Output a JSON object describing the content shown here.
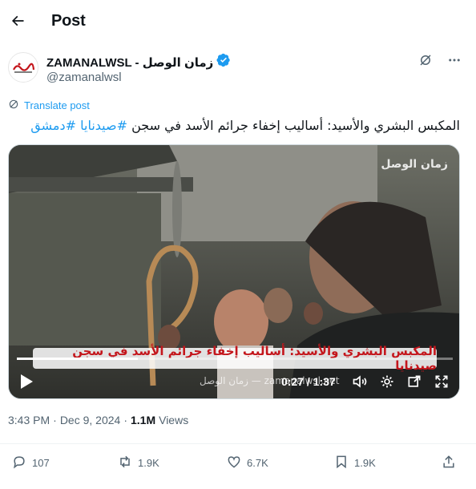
{
  "header": {
    "title": "Post"
  },
  "author": {
    "display_name": "ZAMANALWSL - زمان الوصل",
    "handle": "@zamanalwsl",
    "verified": true,
    "avatar_text": "زمان الوصل"
  },
  "translate_label": "Translate post",
  "post": {
    "text": "المكبس البشري والأسيد: أساليب إخفاء جرائم الأسد في سجن ",
    "hashtags": [
      "#صيدنايا",
      "#دمشق"
    ]
  },
  "video": {
    "caption": "المكبس البشري والأسيد: أساليب إخفاء جرائم الأسد في سجن صيدنايا",
    "time": "0:27 / 1:37",
    "progress": 0.278,
    "watermark": "زمان الوصل",
    "watermark_bottom": "zamanalwsl.net — زمان الوصل"
  },
  "meta": {
    "time": "3:43 PM",
    "date": "Dec 9, 2024",
    "views_count": "1.1M",
    "views_label": "Views",
    "separator": "·"
  },
  "actions": {
    "replies": "107",
    "reposts": "1.9K",
    "likes": "6.7K",
    "bookmarks": "1.9K"
  },
  "colors": {
    "accent": "#1d9bf0",
    "caption_red": "#c4161c",
    "text": "#0f1419",
    "muted": "#536471"
  }
}
